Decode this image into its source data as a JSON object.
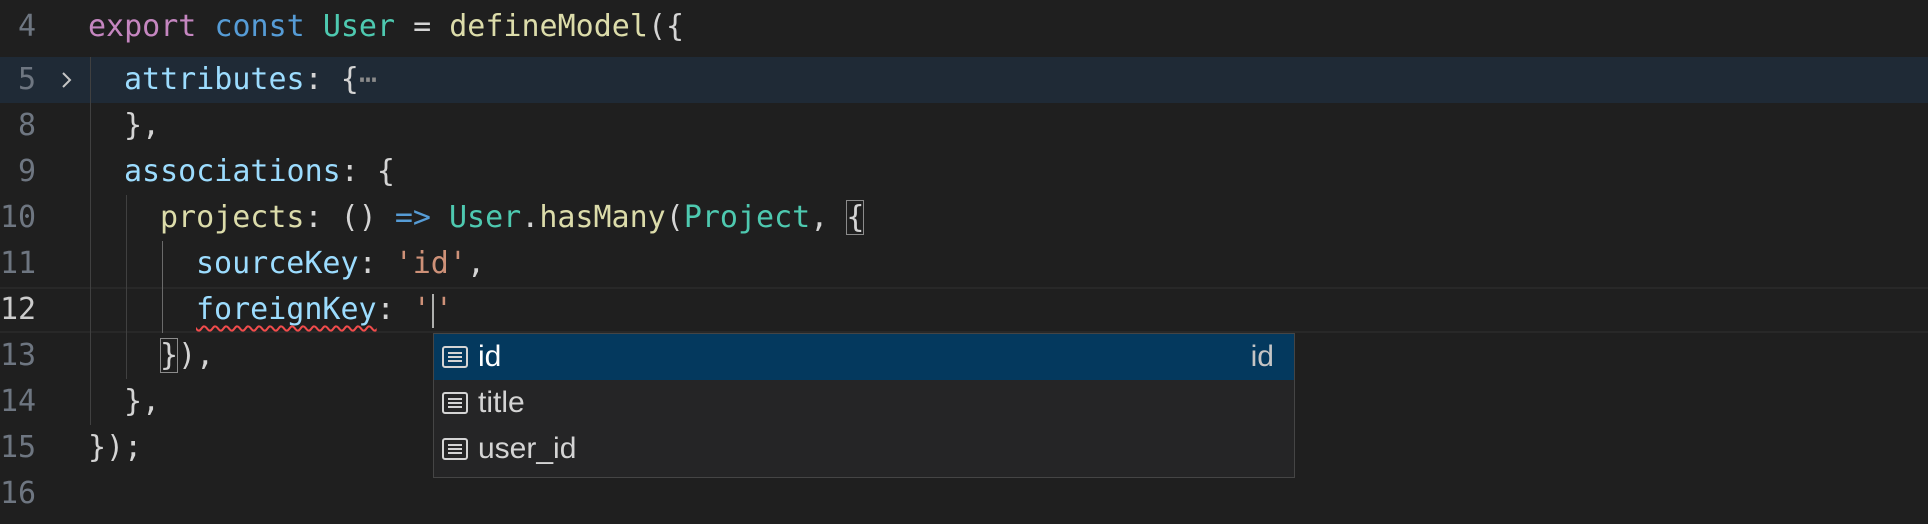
{
  "editor": {
    "lines": [
      {
        "number": "4"
      },
      {
        "number": "5"
      },
      {
        "number": "8"
      },
      {
        "number": "9"
      },
      {
        "number": "10"
      },
      {
        "number": "11"
      },
      {
        "number": "12"
      },
      {
        "number": "13"
      },
      {
        "number": "14"
      },
      {
        "number": "15"
      },
      {
        "number": "16"
      }
    ],
    "tokens": {
      "l4_export": "export",
      "l4_const": "const",
      "l4_user": "User",
      "l4_eq": " = ",
      "l4_define": "defineModel",
      "l4_open": "({",
      "l5_attributes": "attributes",
      "l5_colon": ": {",
      "l5_ellipsis": "⋯",
      "l8_close": "},",
      "l9_associations": "associations",
      "l9_colon": ": {",
      "l10_projects": "projects",
      "l10_colon": ": () ",
      "l10_arrow": "=>",
      "l10_user": "User",
      "l10_dot": ".",
      "l10_hasmany": "hasMany",
      "l10_paren": "(",
      "l10_project": "Project",
      "l10_comma": ", ",
      "l10_brace": "{",
      "l11_sourcekey": "sourceKey",
      "l11_colon": ": ",
      "l11_str": "'id'",
      "l11_comma": ",",
      "l12_foreignkey": "foreignKey",
      "l12_colon": ": ",
      "l12_quote_open": "'",
      "l12_quote_close": "'",
      "l13_brace": "}",
      "l13_rest": "),",
      "l14_close": "},",
      "l15_close": "});"
    }
  },
  "suggest": {
    "items": [
      {
        "label": "id",
        "detail": "id",
        "icon": "field-icon"
      },
      {
        "label": "title",
        "detail": "",
        "icon": "field-icon"
      },
      {
        "label": "user_id",
        "detail": "",
        "icon": "field-icon"
      }
    ]
  }
}
